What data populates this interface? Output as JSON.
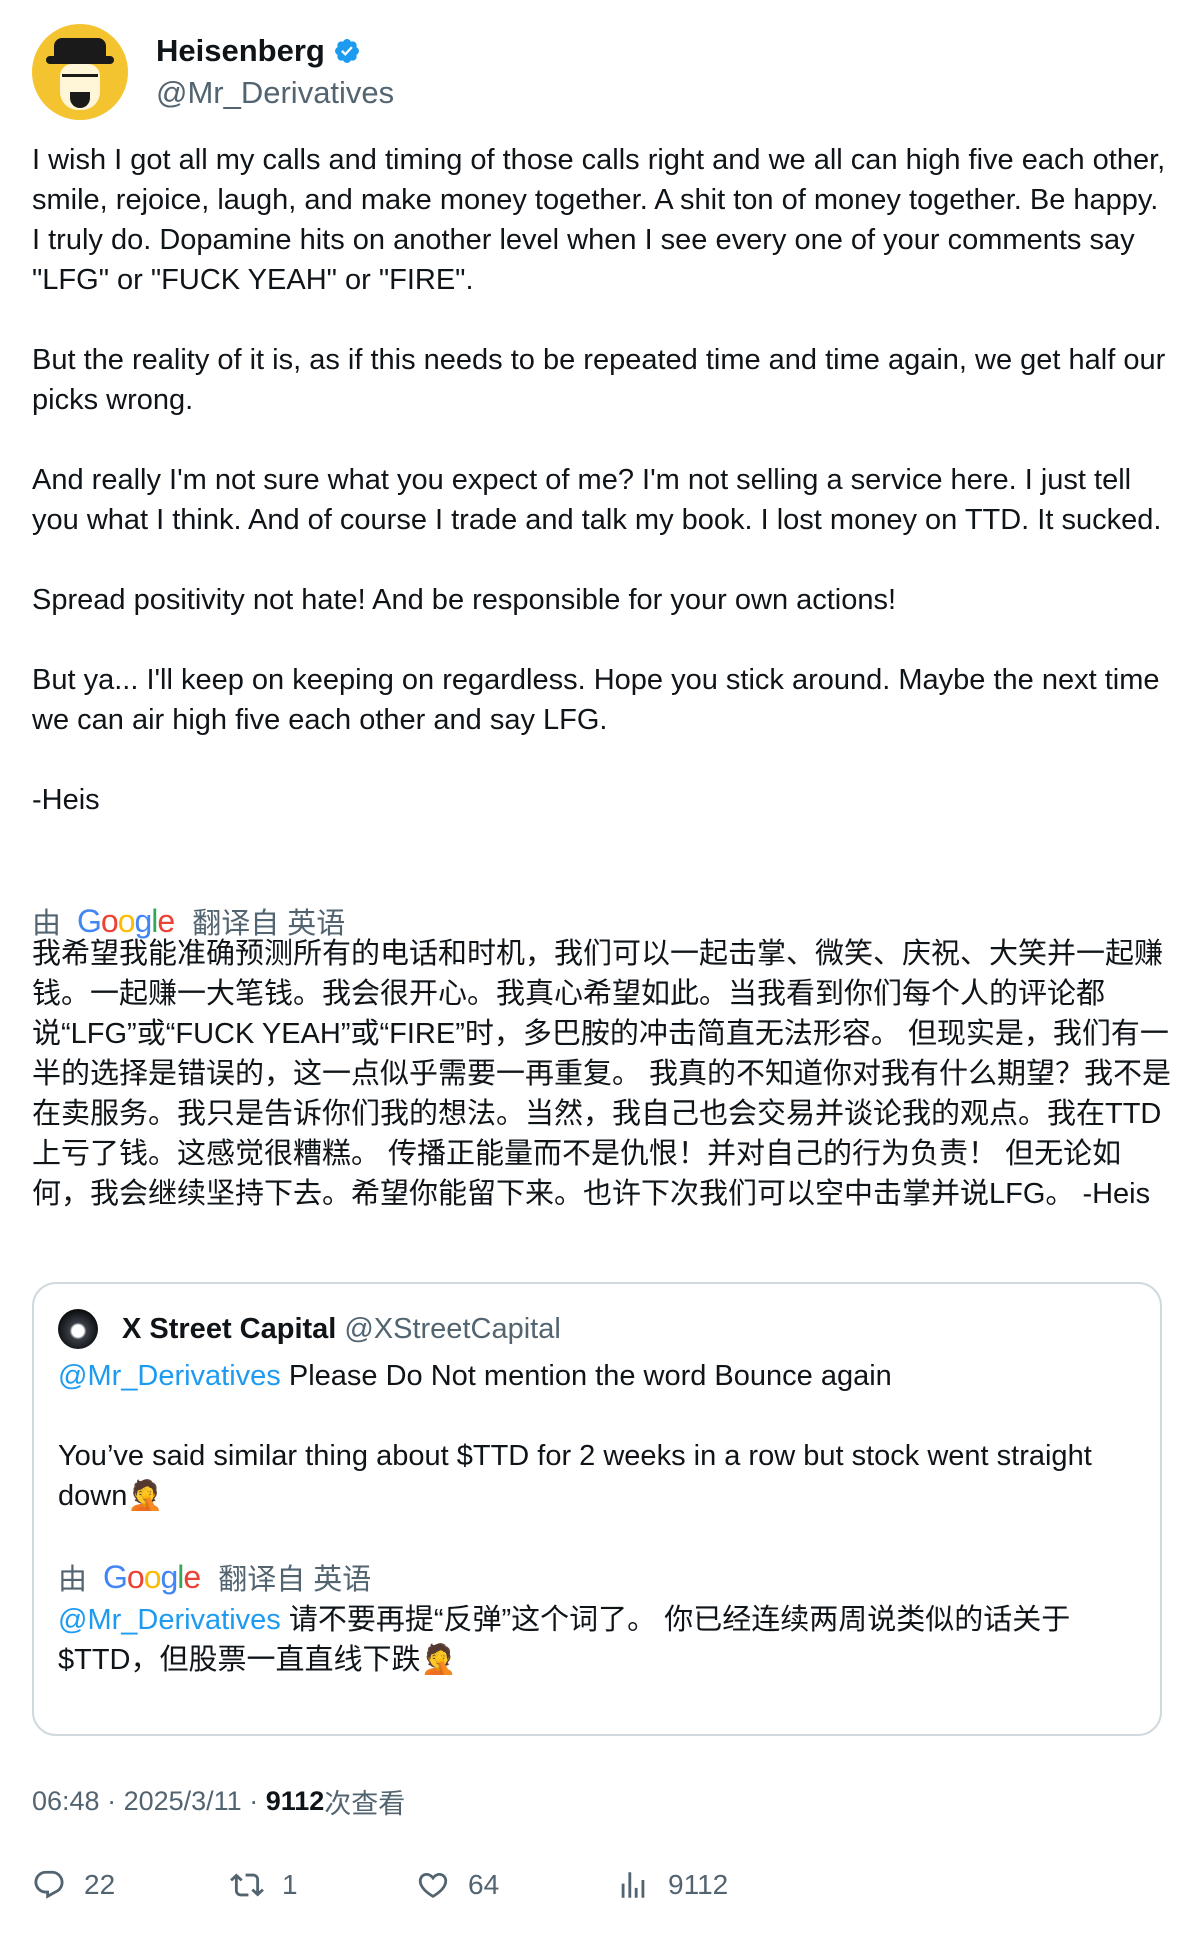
{
  "author": {
    "name": "Heisenberg",
    "handle": "@Mr_Derivatives",
    "verified": true
  },
  "tweet": {
    "text": "I wish I got all my calls and timing of those calls right and we all can high five each other, smile, rejoice, laugh, and make money together. A shit ton of money together. Be happy. I truly do. Dopamine hits on another level when I see every one of your comments say \"LFG\" or \"FUCK YEAH\" or \"FIRE\".\n\nBut the reality of it is, as if this needs to be repeated time and time again, we get half our picks wrong.\n\nAnd really I'm not sure what you expect of me? I'm not selling a service here. I just tell you what I think. And of course I trade and talk my book. I lost money on TTD. It sucked.\n\nSpread positivity not hate! And be responsible for your own actions!\n\nBut ya... I'll keep on keeping on regardless. Hope you stick around. Maybe the next time we can air high five each other and say LFG.\n\n-Heis",
    "translation_prefix": "由",
    "translation_suffix": "翻译自 英语",
    "translated_text": "我希望我能准确预测所有的电话和时机，我们可以一起击掌、微笑、庆祝、大笑并一起赚钱。一起赚一大笔钱。我会很开心。我真心希望如此。当我看到你们每个人的评论都说“LFG”或“FUCK YEAH”或“FIRE”时，多巴胺的冲击简直无法形容。 但现实是，我们有一半的选择是错误的，这一点似乎需要一再重复。 我真的不知道你对我有什么期望？我不是在卖服务。我只是告诉你们我的想法。当然，我自己也会交易并谈论我的观点。我在TTD上亏了钱。这感觉很糟糕。 传播正能量而不是仇恨！并对自己的行为负责！ 但无论如何，我会继续坚持下去。希望你能留下来。也许下次我们可以空中击掌并说LFG。 -Heis"
  },
  "quoted_tweet": {
    "name": "X Street Capital",
    "handle": "@XStreetCapital",
    "mention": "@Mr_Derivatives",
    "line1": " Please Do Not mention the word Bounce again",
    "text_rest": "You’ve said similar thing about $TTD for 2 weeks in a row but stock went straight down🤦",
    "translation_prefix": "由",
    "translation_suffix": "翻译自 英语",
    "translated_mention": "@Mr_Derivatives",
    "translated_text": " 请不要再提“反弹”这个词了。 你已经连续两周说类似的话关于$TTD，但股票一直直线下跌🤦"
  },
  "google_letters": [
    "G",
    "o",
    "o",
    "g",
    "l",
    "e"
  ],
  "meta": {
    "time": "06:48",
    "separator": " · ",
    "date": "2025/3/11",
    "separator2": " · ",
    "views": "9112",
    "views_label": "次查看"
  },
  "actions": {
    "replies": "22",
    "retweets": "1",
    "likes": "64",
    "views": "9112"
  },
  "colors": {
    "text": "#0f1419",
    "secondary": "#536471",
    "link": "#1d9bf0",
    "border": "#cfd9de",
    "verified": "#1d9bf0"
  }
}
